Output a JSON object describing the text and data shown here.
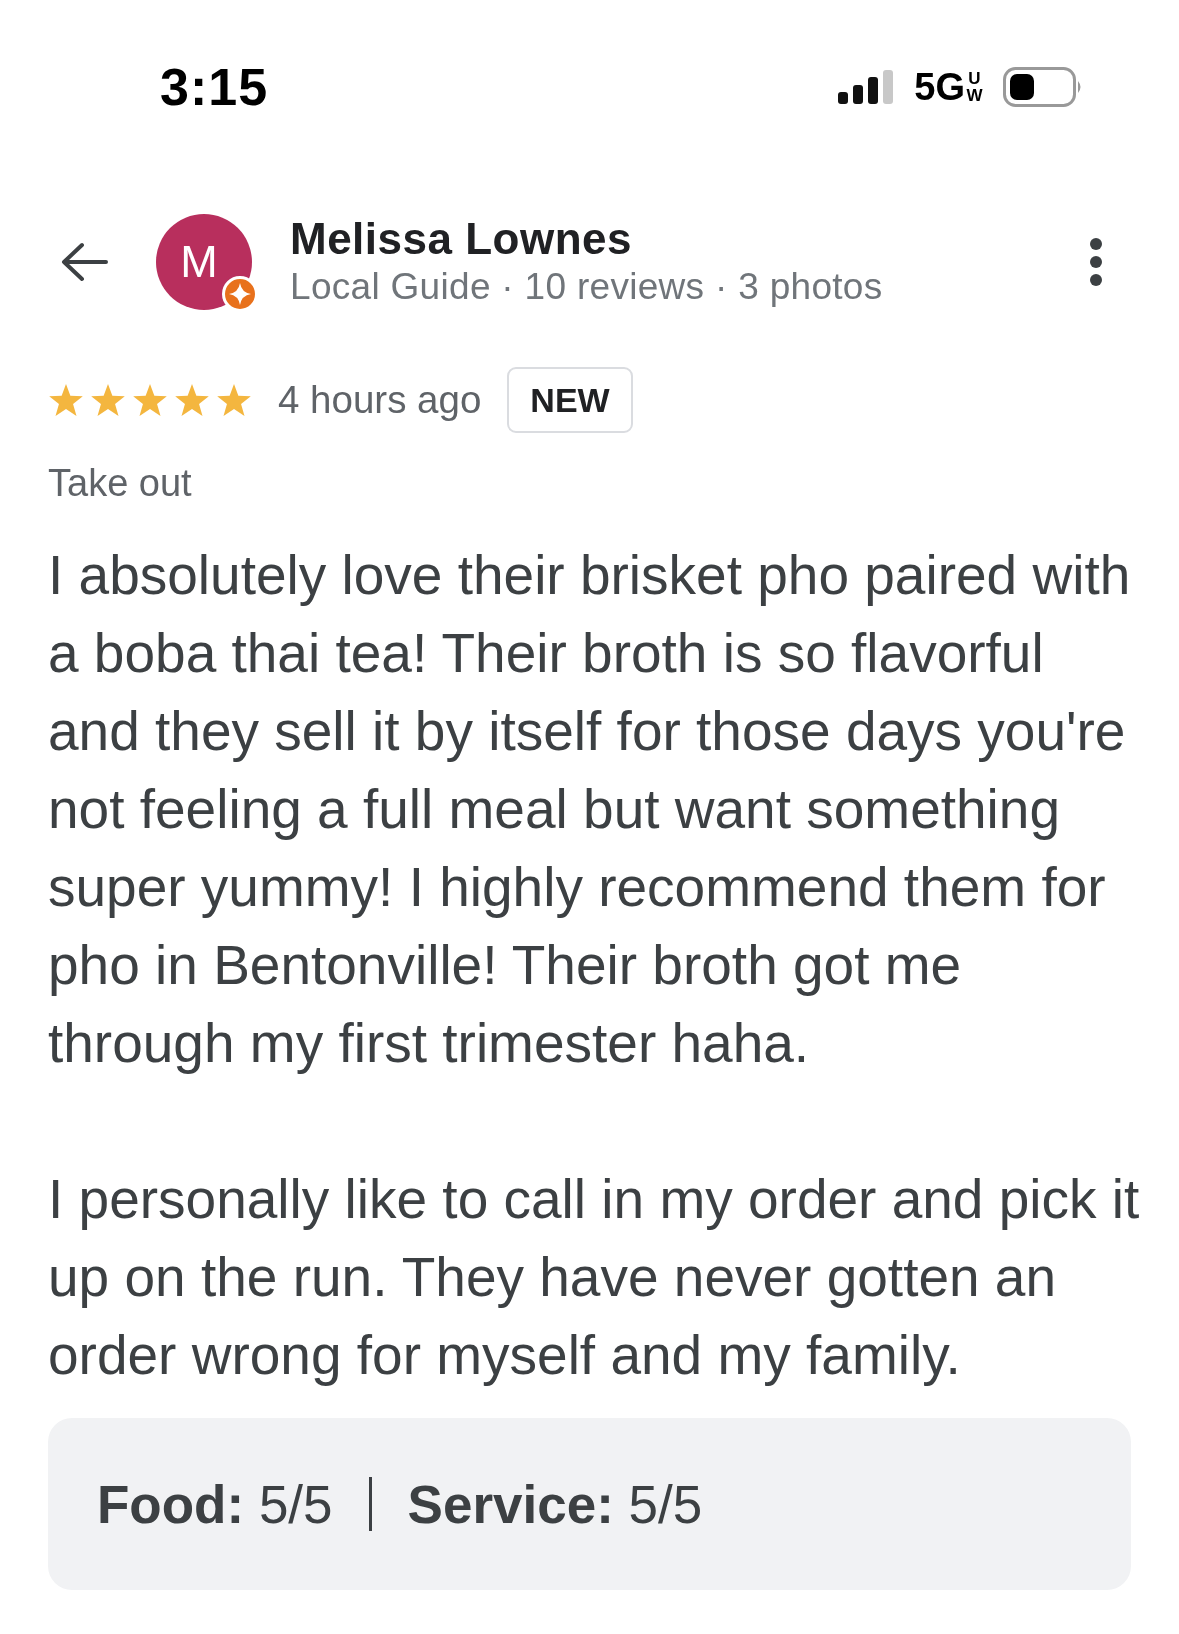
{
  "status_bar": {
    "time": "3:15",
    "network": "5G",
    "network_badge": "UW"
  },
  "header": {
    "avatar_letter": "M",
    "name": "Melissa Lownes",
    "meta": "Local Guide · 10 reviews · 3 photos"
  },
  "review": {
    "stars": 5,
    "time": "4 hours ago",
    "badge": "NEW",
    "service_type": "Take out",
    "paragraphs": [
      "I absolutely love their brisket pho paired with a boba thai tea! Their broth is so flavorful and they sell it by itself for those days you're not feeling a full meal but want something super yummy! I highly recommend them for pho in Bentonville! Their broth got me through my first trimester haha.",
      "I personally like to call in my order and pick it up on the run. They have never gotten an order wrong for myself and my family."
    ],
    "ratings": [
      {
        "text": "**Food:** 5/5"
      },
      {
        "text": "**Service:** 5/5"
      }
    ]
  }
}
